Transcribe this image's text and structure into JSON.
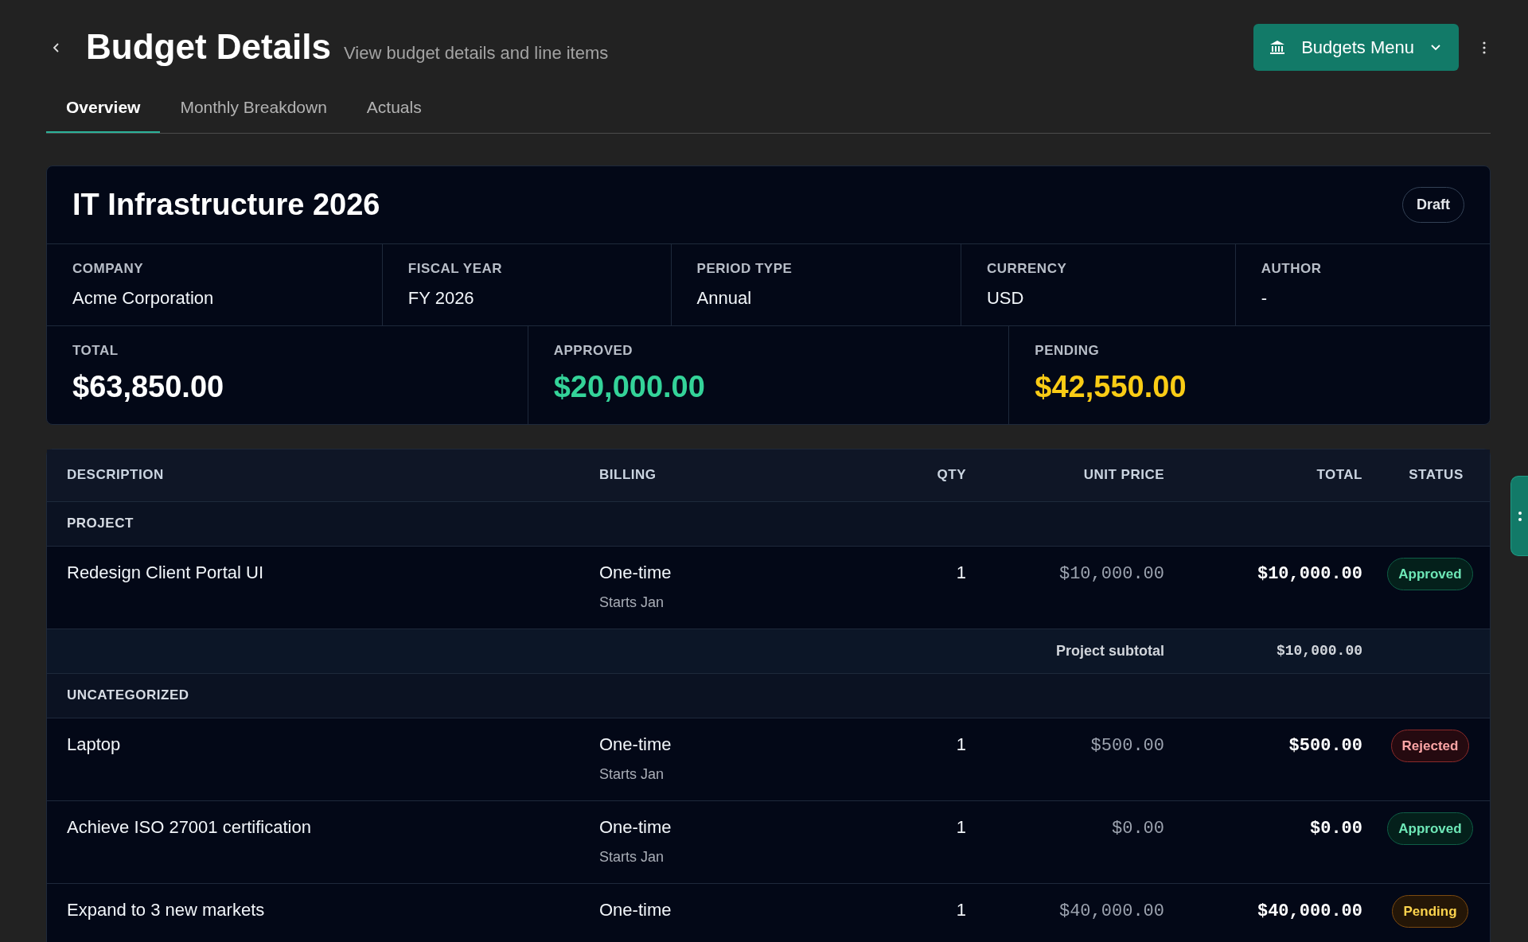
{
  "header": {
    "title": "Budget Details",
    "subtitle": "View budget details and line items",
    "menu_button": "Budgets Menu"
  },
  "tabs": [
    {
      "label": "Overview",
      "selected": true
    },
    {
      "label": "Monthly Breakdown",
      "selected": false
    },
    {
      "label": "Actuals",
      "selected": false
    }
  ],
  "budget": {
    "title": "IT Infrastructure 2026",
    "status": "Draft",
    "meta": [
      {
        "label": "COMPANY",
        "value": "Acme Corporation"
      },
      {
        "label": "FISCAL YEAR",
        "value": "FY 2026"
      },
      {
        "label": "PERIOD TYPE",
        "value": "Annual"
      },
      {
        "label": "CURRENCY",
        "value": "USD"
      },
      {
        "label": "AUTHOR",
        "value": "-"
      }
    ],
    "totals": [
      {
        "label": "TOTAL",
        "value": "$63,850.00",
        "kind": "total"
      },
      {
        "label": "APPROVED",
        "value": "$20,000.00",
        "kind": "approved"
      },
      {
        "label": "PENDING",
        "value": "$42,550.00",
        "kind": "pending"
      }
    ]
  },
  "table": {
    "columns": [
      "DESCRIPTION",
      "BILLING",
      "QTY",
      "UNIT PRICE",
      "TOTAL",
      "STATUS"
    ],
    "groups": [
      {
        "name": "PROJECT",
        "rows": [
          {
            "description": "Redesign Client Portal UI",
            "billing": "One-time",
            "start": "Starts Jan",
            "qty": "1",
            "unit_price": "$10,000.00",
            "total": "$10,000.00",
            "status": "Approved",
            "kind": "approved"
          }
        ],
        "subtotal": {
          "label": "Project subtotal",
          "value": "$10,000.00"
        }
      },
      {
        "name": "UNCATEGORIZED",
        "rows": [
          {
            "description": "Laptop",
            "billing": "One-time",
            "start": "Starts Jan",
            "qty": "1",
            "unit_price": "$500.00",
            "total": "$500.00",
            "status": "Rejected",
            "kind": "rejected"
          },
          {
            "description": "Achieve ISO 27001 certification",
            "billing": "One-time",
            "start": "Starts Jan",
            "qty": "1",
            "unit_price": "$0.00",
            "total": "$0.00",
            "status": "Approved",
            "kind": "approved"
          },
          {
            "description": "Expand to 3 new markets",
            "billing": "One-time",
            "qty": "1",
            "unit_price": "$40,000.00",
            "total": "$40,000.00",
            "status": "Pending",
            "kind": "pending"
          }
        ]
      }
    ]
  }
}
